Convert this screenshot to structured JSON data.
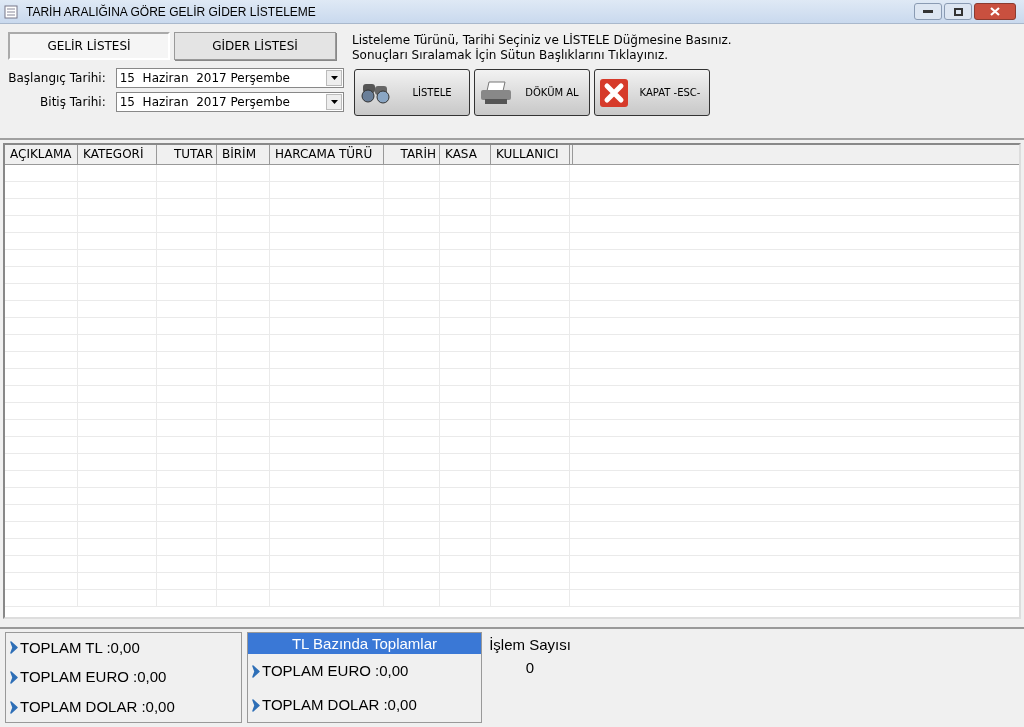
{
  "window": {
    "title": "TARİH ARALIĞINA GÖRE GELİR GİDER  LİSTELEME"
  },
  "tabs": [
    {
      "label": "GELİR LİSTESİ",
      "selected": true
    },
    {
      "label": "GİDER LİSTESİ",
      "selected": false
    }
  ],
  "instructions": [
    "Listeleme Türünü, Tarihi Seçiniz ve LİSTELE Düğmesine Basınız.",
    "Sonuçları Sıralamak İçin Sütun Başlıklarını Tıklayınız."
  ],
  "date_fields": [
    {
      "label": "Başlangıç Tarihi:",
      "value": "15  Haziran  2017 Perşembe"
    },
    {
      "label": "Bitiş Tarihi:",
      "value": "15  Haziran  2017 Perşembe"
    }
  ],
  "buttons": [
    {
      "kind": "list",
      "label": "LİSTELE"
    },
    {
      "kind": "print",
      "label": "DÖKÜM AL"
    },
    {
      "kind": "close",
      "label": "KAPAT -ESC-"
    }
  ],
  "table": {
    "columns": [
      "AÇIKLAMA",
      "KATEGORİ",
      "TUTAR",
      "BİRİM",
      "HARCAMA TÜRÜ",
      "TARİH",
      "KASA",
      "KULLANICI"
    ]
  },
  "totals": [
    "TOPLAM TL :0,00",
    "TOPLAM EURO :0,00",
    "TOPLAM DOLAR :0,00"
  ],
  "tl_based": {
    "title": "TL Bazında Toplamlar",
    "items": [
      "TOPLAM EURO :0,00",
      "TOPLAM DOLAR :0,00"
    ]
  },
  "count": {
    "label": "İşlem Sayısı",
    "value": "0"
  }
}
